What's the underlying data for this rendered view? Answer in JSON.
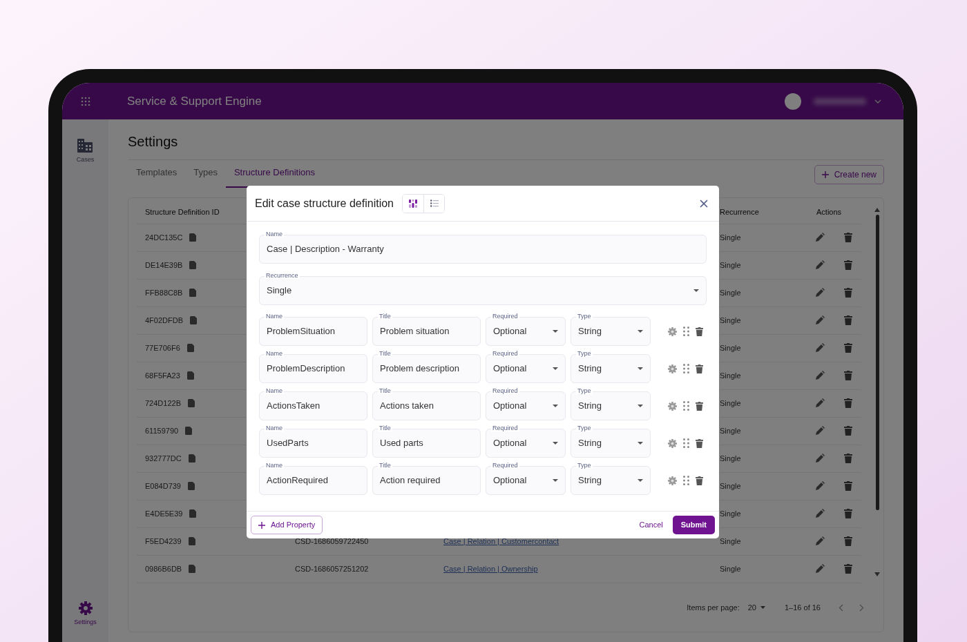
{
  "header": {
    "title": "Service & Support Engine"
  },
  "sidebar": {
    "items": [
      {
        "label": "Cases",
        "kind": "cases",
        "selected": false
      },
      {
        "label": "Settings",
        "kind": "settings",
        "selected": true
      }
    ]
  },
  "page": {
    "title": "Settings",
    "create_button": "Create new"
  },
  "tabs": [
    {
      "label": "Templates",
      "selected": false
    },
    {
      "label": "Types",
      "selected": false
    },
    {
      "label": "Structure Definitions",
      "selected": true
    }
  ],
  "table": {
    "columns": [
      "Structure Definition ID",
      "Recurrence",
      "Actions"
    ],
    "rows": [
      {
        "id": "24DC135C",
        "recurrence": "Single"
      },
      {
        "id": "DE14E39B",
        "recurrence": "Single"
      },
      {
        "id": "FFB88C8B",
        "recurrence": "Single"
      },
      {
        "id": "4F02DFDB",
        "recurrence": "Single"
      },
      {
        "id": "77E706F6",
        "recurrence": "Single"
      },
      {
        "id": "68F5FA23",
        "recurrence": "Single"
      },
      {
        "id": "724D122B",
        "recurrence": "Single"
      },
      {
        "id": "61159790",
        "recurrence": "Single"
      },
      {
        "id": "932777DC",
        "recurrence": "Single"
      },
      {
        "id": "E084D739",
        "recurrence": "Single"
      },
      {
        "id": "E4DE5E39",
        "recurrence": "Single"
      },
      {
        "id": "F5ED4239",
        "column_2": "CSD-1686059722450",
        "column_3": "Case | Relation | Customercontact",
        "recurrence": "Single"
      },
      {
        "id": "0986B6DB",
        "column_2": "CSD-1686057251202",
        "column_3": "Case | Relation | Ownership",
        "recurrence": "Single"
      }
    ]
  },
  "pagination": {
    "items_per_page_label": "Items per page:",
    "items_per_page": "20",
    "range": "1–16 of 16"
  },
  "modal": {
    "title": "Edit case structure definition",
    "view_toggle": [
      {
        "kind": "board",
        "selected": true
      },
      {
        "kind": "list",
        "selected": false
      }
    ],
    "name": {
      "label": "Name",
      "value": "Case | Description - Warranty"
    },
    "recurrence": {
      "label": "Recurrence",
      "value": "Single"
    },
    "properties": [
      {
        "fields": [
          {
            "label": "Name",
            "value": "ProblemSituation",
            "kind": "text"
          },
          {
            "label": "Title",
            "value": "Problem situation",
            "kind": "text"
          },
          {
            "label": "Required",
            "value": "Optional",
            "kind": "select"
          },
          {
            "label": "Type",
            "value": "String",
            "kind": "select"
          }
        ]
      },
      {
        "fields": [
          {
            "label": "Name",
            "value": "ProblemDescription",
            "kind": "text"
          },
          {
            "label": "Title",
            "value": "Problem description",
            "kind": "text"
          },
          {
            "label": "Required",
            "value": "Optional",
            "kind": "select"
          },
          {
            "label": "Type",
            "value": "String",
            "kind": "select"
          }
        ]
      },
      {
        "fields": [
          {
            "label": "Name",
            "value": "ActionsTaken",
            "kind": "text"
          },
          {
            "label": "Title",
            "value": "Actions taken",
            "kind": "text"
          },
          {
            "label": "Required",
            "value": "Optional",
            "kind": "select"
          },
          {
            "label": "Type",
            "value": "String",
            "kind": "select"
          }
        ]
      },
      {
        "fields": [
          {
            "label": "Name",
            "value": "UsedParts",
            "kind": "text"
          },
          {
            "label": "Title",
            "value": "Used parts",
            "kind": "text"
          },
          {
            "label": "Required",
            "value": "Optional",
            "kind": "select"
          },
          {
            "label": "Type",
            "value": "String",
            "kind": "select"
          }
        ]
      },
      {
        "fields": [
          {
            "label": "Name",
            "value": "ActionRequired",
            "kind": "text"
          },
          {
            "label": "Title",
            "value": "Action required",
            "kind": "text"
          },
          {
            "label": "Required",
            "value": "Optional",
            "kind": "select"
          },
          {
            "label": "Type",
            "value": "String",
            "kind": "select"
          }
        ]
      }
    ],
    "add_button": "Add Property",
    "cancel_button": "Cancel",
    "submit_button": "Submit"
  }
}
